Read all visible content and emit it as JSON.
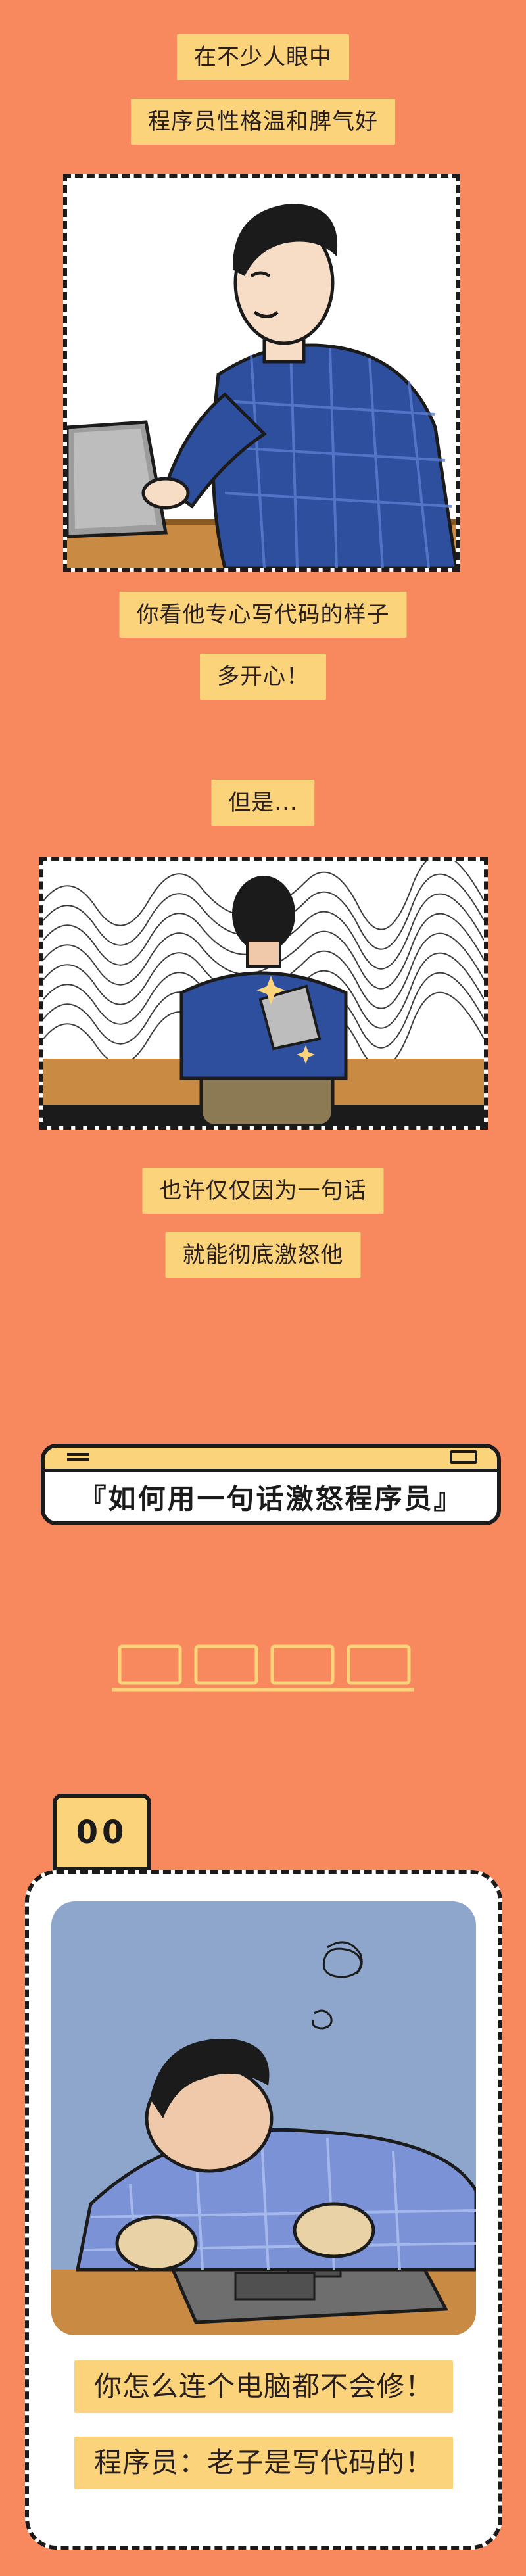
{
  "panel1": {
    "caption_1": "在不少人眼中",
    "caption_2": "程序员性格温和脾气好",
    "caption_3": "你看他专心写代码的样子",
    "caption_4": "多开心！"
  },
  "panel2": {
    "caption_1": "但是...",
    "caption_2": "也许仅仅因为一句话",
    "caption_3": "就能彻底激怒他"
  },
  "title_banner": {
    "text": "『如何用一句话激怒程序员』"
  },
  "section_00": {
    "number": "00",
    "caption_1": "你怎么连个电脑都不会修！",
    "caption_2": "程序员：老子是写代码的！"
  },
  "colors": {
    "background": "#F8885E",
    "caption_bg": "#FBD37B",
    "ink": "#1B1B1B",
    "shirt": "#2E4E9E",
    "desk": "#C98B44"
  }
}
